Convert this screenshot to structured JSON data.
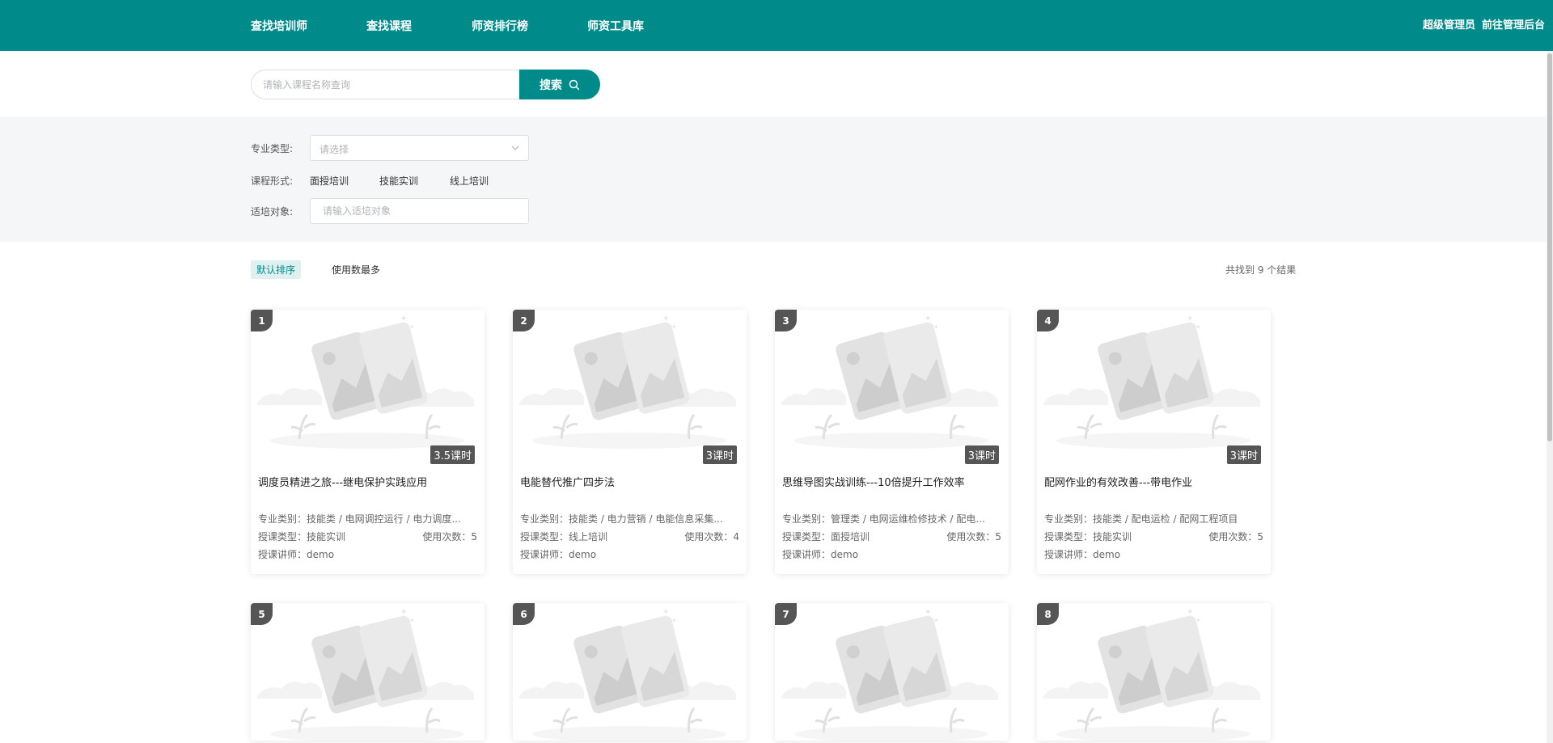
{
  "header": {
    "nav": [
      "查找培训师",
      "查找课程",
      "师资排行榜",
      "师资工具库"
    ],
    "user": "超级管理员",
    "admin_link": "前往管理后台"
  },
  "search": {
    "placeholder": "请输入课程名称查询",
    "button": "搜索"
  },
  "filters": {
    "major_label": "专业类型:",
    "major_placeholder": "请选择",
    "form_label": "课程形式:",
    "form_options": [
      "面授培训",
      "技能实训",
      "线上培训"
    ],
    "target_label": "适培对象:",
    "target_placeholder": "请输入适培对象"
  },
  "sort": {
    "default": "默认排序",
    "usage": "使用数最多",
    "result_text": "共找到 9 个结果"
  },
  "colors": {
    "primary": "#008b8b",
    "badge": "#555555",
    "panel": "#f5f6f8"
  },
  "courses": [
    {
      "num": "1",
      "hours": "3.5课时",
      "title": "调度员精进之旅---继电保护实践应用",
      "category": "专业类别：技能类 / 电网调控运行 / 电力调度...",
      "type": "授课类型：技能实训",
      "usage": "使用次数：5",
      "teacher": "授课讲师：demo"
    },
    {
      "num": "2",
      "hours": "3课时",
      "title": "电能替代推广四步法",
      "category": "专业类别：技能类 / 电力营销 / 电能信息采集...",
      "type": "授课类型：线上培训",
      "usage": "使用次数：4",
      "teacher": "授课讲师：demo"
    },
    {
      "num": "3",
      "hours": "3课时",
      "title": "思维导图实战训练---10倍提升工作效率",
      "category": "专业类别：管理类 / 电网运维检修技术 / 配电...",
      "type": "授课类型：面授培训",
      "usage": "使用次数：5",
      "teacher": "授课讲师：demo"
    },
    {
      "num": "4",
      "hours": "3课时",
      "title": "配网作业的有效改善---带电作业",
      "category": "专业类别：技能类 / 配电运检 / 配网工程项目",
      "type": "授课类型：技能实训",
      "usage": "使用次数：5",
      "teacher": "授课讲师：demo"
    },
    {
      "num": "5"
    },
    {
      "num": "6"
    },
    {
      "num": "7"
    },
    {
      "num": "8"
    }
  ]
}
